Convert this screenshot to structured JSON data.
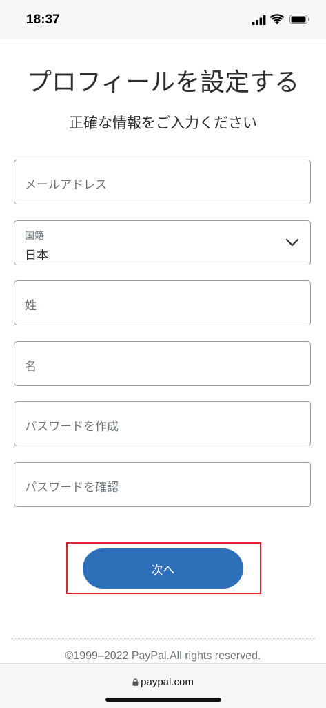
{
  "status_bar": {
    "time": "18:37",
    "icons": [
      "cellular-signal-icon",
      "wifi-icon",
      "battery-icon"
    ]
  },
  "header": {
    "title": "プロフィールを設定する",
    "subtitle": "正確な情報をご入力ください"
  },
  "form": {
    "email": {
      "placeholder": "メールアドレス",
      "value": ""
    },
    "nationality": {
      "label": "国籍",
      "value": "日本"
    },
    "last_name": {
      "placeholder": "姓",
      "value": ""
    },
    "first_name": {
      "placeholder": "名",
      "value": ""
    },
    "password": {
      "placeholder": "パスワードを作成",
      "value": ""
    },
    "password_confirm": {
      "placeholder": "パスワードを確認",
      "value": ""
    }
  },
  "actions": {
    "next_label": "次へ"
  },
  "footer": {
    "copyright": "©1999–2022 PayPal.All rights reserved."
  },
  "browser": {
    "url": "paypal.com"
  },
  "colors": {
    "primary_button": "#2d6fb8",
    "highlight_border": "#e0242c",
    "text": "#2c2e2f",
    "placeholder": "#6c7378"
  }
}
